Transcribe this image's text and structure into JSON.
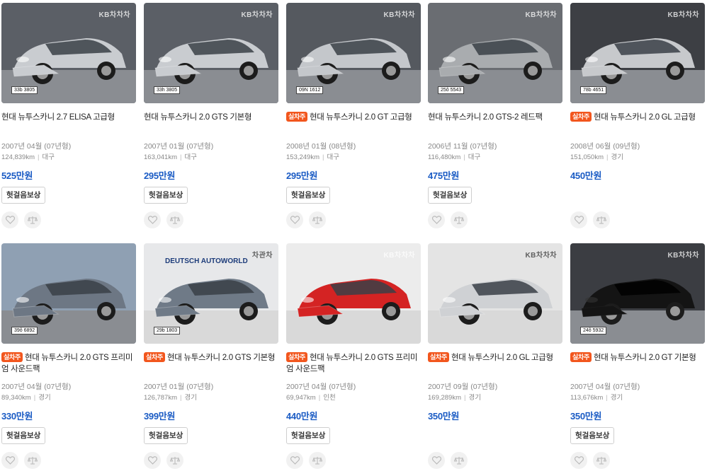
{
  "listings": [
    {
      "badge": "",
      "title": "현대 뉴투스카니 2.7 ELISA 고급형",
      "year": "2007년 04월 (07년형)",
      "mileage": "124,839km",
      "region": "대구",
      "price": "525만원",
      "refund": "헛걸음보상",
      "plate": "33b 3805",
      "watermark": "KB차차차",
      "car_color": "#c9ccd0",
      "bg_color": "#5b5f66"
    },
    {
      "badge": "",
      "title": "현대 뉴투스카니 2.0 GTS 기본형",
      "year": "2007년 01월 (07년형)",
      "mileage": "163,041km",
      "region": "대구",
      "price": "295만원",
      "refund": "헛걸음보상",
      "plate": "33h 3805",
      "watermark": "KB차차차",
      "car_color": "#c9ccd0",
      "bg_color": "#5b5f66"
    },
    {
      "badge": "실차주",
      "title": "현대 뉴투스카니 2.0 GT 고급형",
      "year": "2008년 01월 (08년형)",
      "mileage": "153,249km",
      "region": "대구",
      "price": "295만원",
      "refund": "헛걸음보상",
      "plate": "09N 1612",
      "watermark": "KB차차차",
      "car_color": "#c4c7cb",
      "bg_color": "#55595f"
    },
    {
      "badge": "",
      "title": "현대 뉴투스카니 2.0 GTS-2 레드팩",
      "year": "2006년 11월 (07년형)",
      "mileage": "116,480km",
      "region": "대구",
      "price": "475만원",
      "refund": "헛걸음보상",
      "plate": "25ô 5543",
      "watermark": "KB차차차",
      "car_color": "#a9acaf",
      "bg_color": "#6a6d72"
    },
    {
      "badge": "실차주",
      "title": "현대 뉴투스카니 2.0 GL 고급형",
      "year": "2008년 06월 (09년형)",
      "mileage": "151,050km",
      "region": "경기",
      "price": "450만원",
      "refund": "",
      "plate": "78b 4651",
      "watermark": "KB차차차",
      "car_color": "#c7c9cc",
      "bg_color": "#3d3f44"
    },
    {
      "badge": "실차주",
      "title": "현대 뉴투스카니 2.0 GTS 프리미엄 사운드팩",
      "year": "2007년 04월 (07년형)",
      "mileage": "89,340km",
      "region": "경기",
      "price": "330만원",
      "refund": "헛걸음보상",
      "plate": "39ô 6892",
      "watermark": "",
      "car_color": "#6d7784",
      "bg_color": "#8fa0b3"
    },
    {
      "badge": "실차주",
      "title": "현대 뉴투스카니 2.0 GTS 기본형",
      "year": "2007년 01월 (07년형)",
      "mileage": "126,787km",
      "region": "경기",
      "price": "399만원",
      "refund": "헛걸음보상",
      "plate": "29b 1803",
      "watermark": "차관차",
      "dealer_sign": "DEUTSCH AUTOWORLD",
      "car_color": "#6f7a87",
      "bg_color": "#e7e8ea"
    },
    {
      "badge": "실차주",
      "title": "현대 뉴투스카니 2.0 GTS 프리미엄 사운드팩",
      "year": "2007년 04월 (07년형)",
      "mileage": "69,947km",
      "region": "인천",
      "price": "440만원",
      "refund": "헛걸음보상",
      "plate": "",
      "watermark": "KB차차차",
      "car_color": "#d42323",
      "bg_color": "#ececec"
    },
    {
      "badge": "실차주",
      "title": "현대 뉴투스카니 2.0 GL 고급형",
      "year": "2007년 09월 (07년형)",
      "mileage": "169,289km",
      "region": "경기",
      "price": "350만원",
      "refund": "",
      "plate": "",
      "watermark": "KB차차차",
      "car_color": "#cfd1d4",
      "bg_color": "#e4e4e4"
    },
    {
      "badge": "실차주",
      "title": "현대 뉴투스카니 2.0 GT 기본형",
      "year": "2007년 04월 (07년형)",
      "mileage": "113,676km",
      "region": "경기",
      "price": "350만원",
      "refund": "헛걸음보상",
      "plate": "24ô 5932",
      "watermark": "KB차차차",
      "car_color": "#141414",
      "bg_color": "#3b3d42"
    }
  ],
  "icons": {
    "heart": "heart-icon",
    "compare": "scale-icon"
  },
  "colors": {
    "price": "#1a5bc4",
    "badge": "#f2561d"
  }
}
